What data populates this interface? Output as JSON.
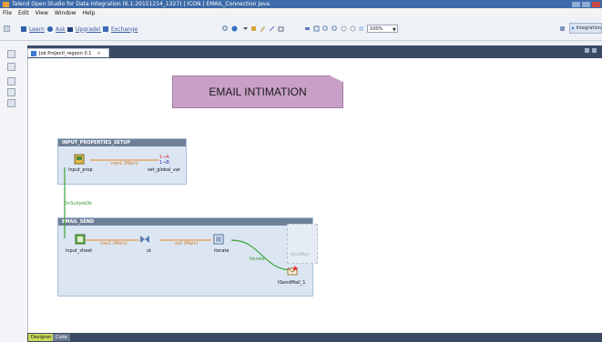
{
  "window": {
    "title": "Talend Open Studio for Data Integration (6.1.20151214_1327) | ICON | EMAIL_Connection Java"
  },
  "menubar": {
    "items": [
      "File",
      "Edit",
      "View",
      "Window",
      "Help"
    ]
  },
  "toolbar": {
    "links": [
      "Learn",
      "Ask",
      "Upgrade!",
      "Exchange"
    ],
    "zoom_value": "100%",
    "perspective_label": "Integration"
  },
  "editor": {
    "tab_label": "Job ProjectI_regeon 0.1",
    "close_symbol": "×"
  },
  "canvas": {
    "note_text": "EMAIL INTIMATION",
    "subjobs": [
      {
        "title": "INPUT_PROPERTIES_SETUP",
        "components": [
          "input_prop",
          "set_global_var"
        ],
        "links": [
          "row1 (Main)"
        ]
      },
      {
        "title": "EMAIL_SEND",
        "components": [
          "input_sheet",
          "ut",
          "iterate",
          "tSendMail_1"
        ],
        "links": [
          "row1 (Main)",
          "out (Main)",
          "Iterate"
        ]
      }
    ],
    "trigger_label": "OnSubjobOk",
    "ghost_label": "tSendMail"
  },
  "bottom_tabs": [
    "Designer",
    "Code"
  ],
  "colors": {
    "accent_note": "#c8a0c7",
    "subjob_header": "#6e8097",
    "main_link": "#e69a4a",
    "trigger_link": "#3aa13a",
    "designer_tab": "#cdd95a"
  }
}
